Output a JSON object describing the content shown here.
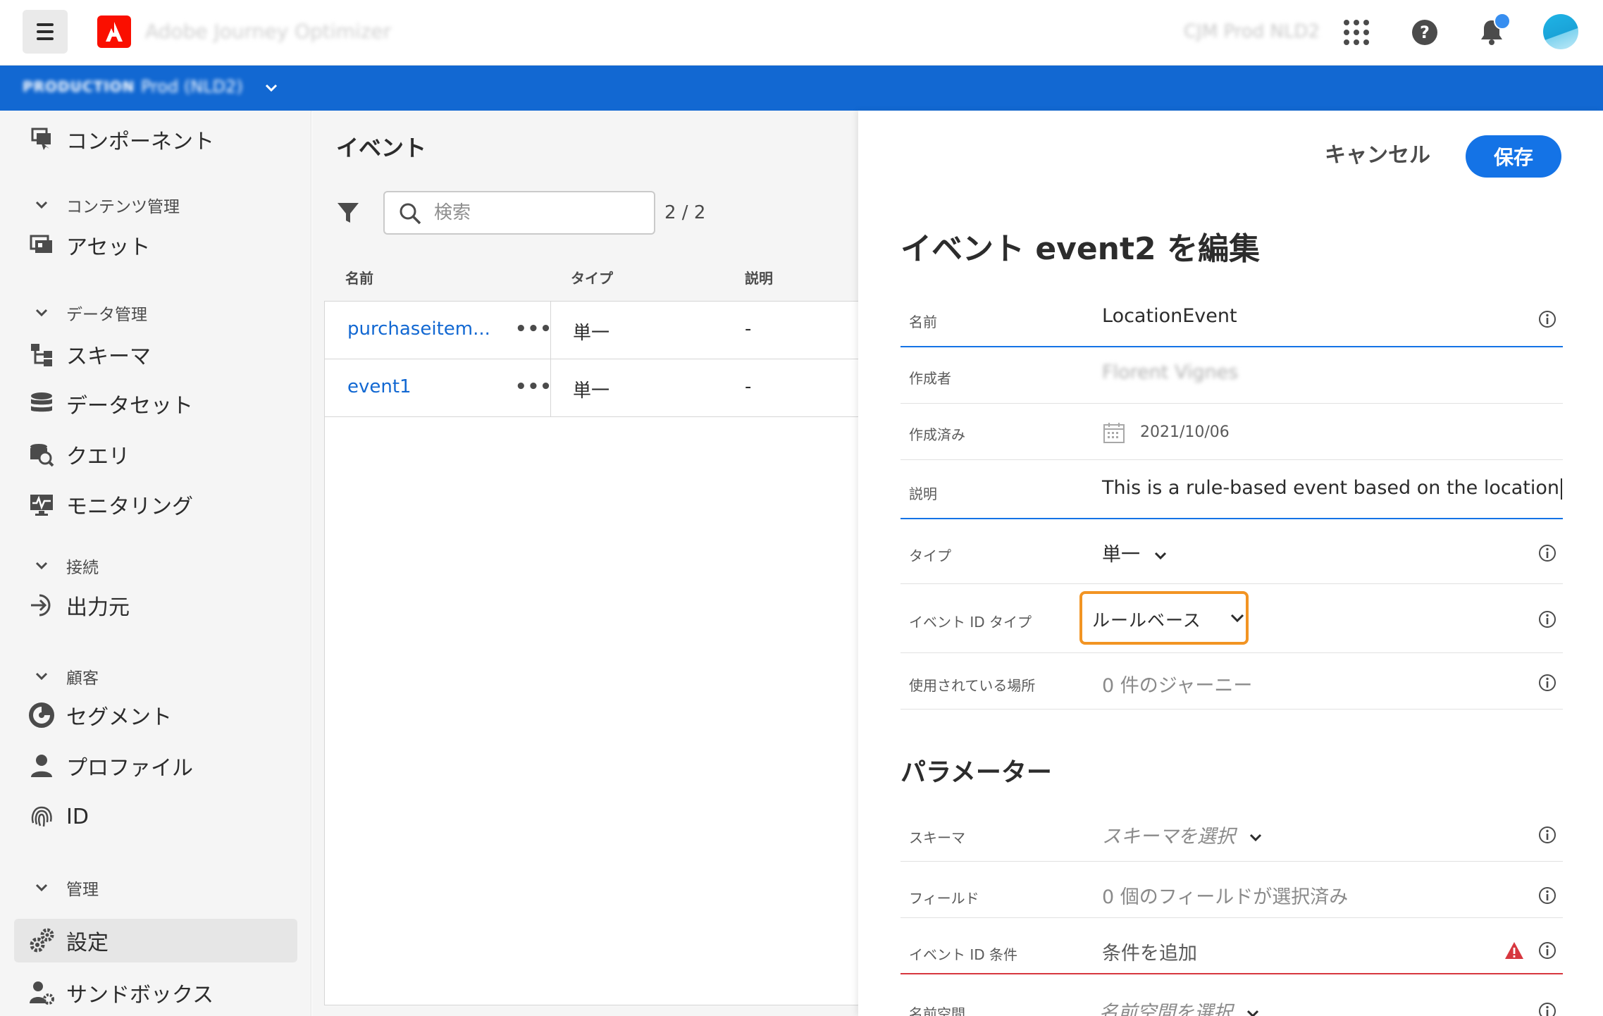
{
  "header": {
    "app_title": "Adobe Journey Optimizer",
    "org_name": "CJM Prod NLD2"
  },
  "sandbox": {
    "env_label": "PRODUCTION",
    "name": "Prod (NLD2)"
  },
  "leftnav": {
    "items": [
      {
        "label": "コンポーネント",
        "icon": "components-icon"
      },
      {
        "section": "コンテンツ管理"
      },
      {
        "label": "アセット",
        "icon": "assets-icon"
      },
      {
        "section": "データ管理"
      },
      {
        "label": "スキーマ",
        "icon": "schema-icon"
      },
      {
        "label": "データセット",
        "icon": "dataset-icon"
      },
      {
        "label": "クエリ",
        "icon": "query-icon"
      },
      {
        "label": "モニタリング",
        "icon": "monitoring-icon"
      },
      {
        "section": "接続"
      },
      {
        "label": "出力元",
        "icon": "destination-icon"
      },
      {
        "section": "顧客"
      },
      {
        "label": "セグメント",
        "icon": "segment-icon"
      },
      {
        "label": "プロファイル",
        "icon": "profile-icon"
      },
      {
        "label": "ID",
        "icon": "fingerprint-icon"
      },
      {
        "section": "管理"
      },
      {
        "label": "設定",
        "icon": "gears-icon",
        "active": true
      },
      {
        "label": "サンドボックス",
        "icon": "sandbox-icon"
      }
    ]
  },
  "events_list": {
    "title": "イベント",
    "search_placeholder": "検索",
    "count": "2 / 2",
    "columns": [
      "名前",
      "タイプ",
      "説明"
    ],
    "rows": [
      {
        "name": "purchaseitem...",
        "type": "単一",
        "description": "-"
      },
      {
        "name": "event1",
        "type": "単一",
        "description": "-"
      }
    ]
  },
  "edit": {
    "cancel_label": "キャンセル",
    "save_label": "保存",
    "title": "イベント event2 を編集",
    "fields": {
      "name_label": "名前",
      "name_value": "LocationEvent",
      "creator_label": "作成者",
      "creator_value": "Florent Vignes",
      "created_label": "作成済み",
      "created_value": "2021/10/06",
      "description_label": "説明",
      "description_value": "This is a rule-based event based on the location",
      "type_label": "タイプ",
      "type_value": "単一",
      "event_id_type_label": "イベント ID タイプ",
      "event_id_type_value": "ルールベース",
      "used_in_label": "使用されている場所",
      "used_in_value": "0 件のジャーニー"
    },
    "parameters": {
      "title": "パラメーター",
      "schema_label": "スキーマ",
      "schema_value": "スキーマを選択",
      "fields_label": "フィールド",
      "fields_value": "0 個のフィールドが選択済み",
      "condition_label": "イベント ID 条件",
      "condition_value": "条件を追加",
      "namespace_label": "名前空間",
      "namespace_value": "名前空間を選択"
    }
  },
  "colors": {
    "accent": "#1473e6",
    "sandbox_bar": "#1268d2",
    "highlight": "#f29423",
    "error": "#d7373f",
    "brand": "#fa0f00"
  }
}
